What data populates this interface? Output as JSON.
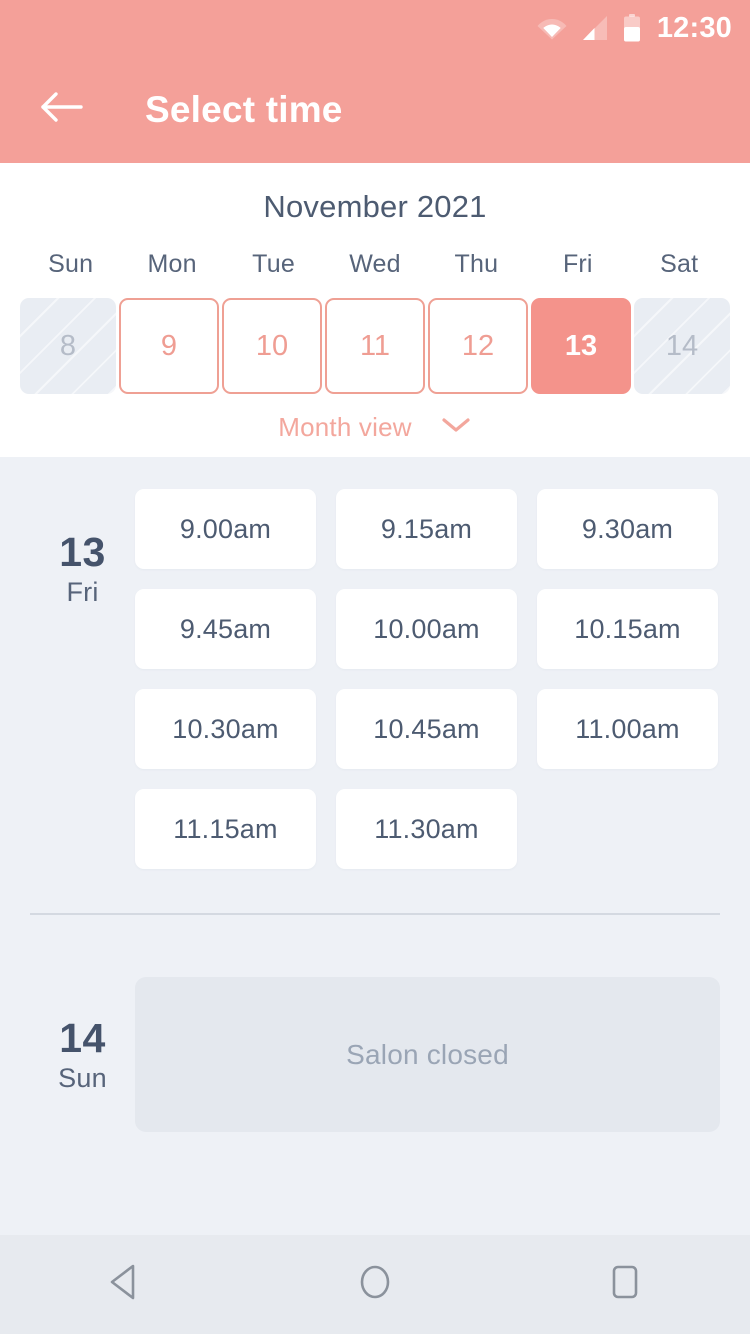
{
  "status_bar": {
    "time": "12:30",
    "icons": [
      "wifi-icon",
      "signal-icon",
      "battery-icon"
    ]
  },
  "app_bar": {
    "back_icon": "back-arrow-icon",
    "title": "Select time"
  },
  "calendar": {
    "month_title": "November 2021",
    "weekdays": [
      "Sun",
      "Mon",
      "Tue",
      "Wed",
      "Thu",
      "Fri",
      "Sat"
    ],
    "days": [
      {
        "number": "8",
        "state": "disabled"
      },
      {
        "number": "9",
        "state": "available"
      },
      {
        "number": "10",
        "state": "available"
      },
      {
        "number": "11",
        "state": "available"
      },
      {
        "number": "12",
        "state": "available"
      },
      {
        "number": "13",
        "state": "selected"
      },
      {
        "number": "14",
        "state": "disabled"
      }
    ],
    "month_view_label": "Month view",
    "month_view_icon": "chevron-down-icon"
  },
  "schedule": {
    "groups": [
      {
        "day_number": "13",
        "day_of_week": "Fri",
        "slots": [
          "9.00am",
          "9.15am",
          "9.30am",
          "9.45am",
          "10.00am",
          "10.15am",
          "10.30am",
          "10.45am",
          "11.00am",
          "11.15am",
          "11.30am"
        ],
        "closed_message": null
      },
      {
        "day_number": "14",
        "day_of_week": "Sun",
        "slots": [],
        "closed_message": "Salon closed"
      }
    ]
  },
  "nav_bar": {
    "buttons": [
      "back-triangle-icon",
      "home-circle-icon",
      "recents-square-icon"
    ]
  },
  "colors": {
    "accent": "#f4a099",
    "accent_selected": "#f4938b",
    "accent_outline": "#efa094",
    "text_dark": "#4d5b71",
    "text_muted": "#9aa5b5",
    "page_bg": "#eef1f6",
    "card_bg": "#ffffff",
    "closed_bg": "#e4e8ee",
    "navbar_bg": "#e7eaef"
  }
}
